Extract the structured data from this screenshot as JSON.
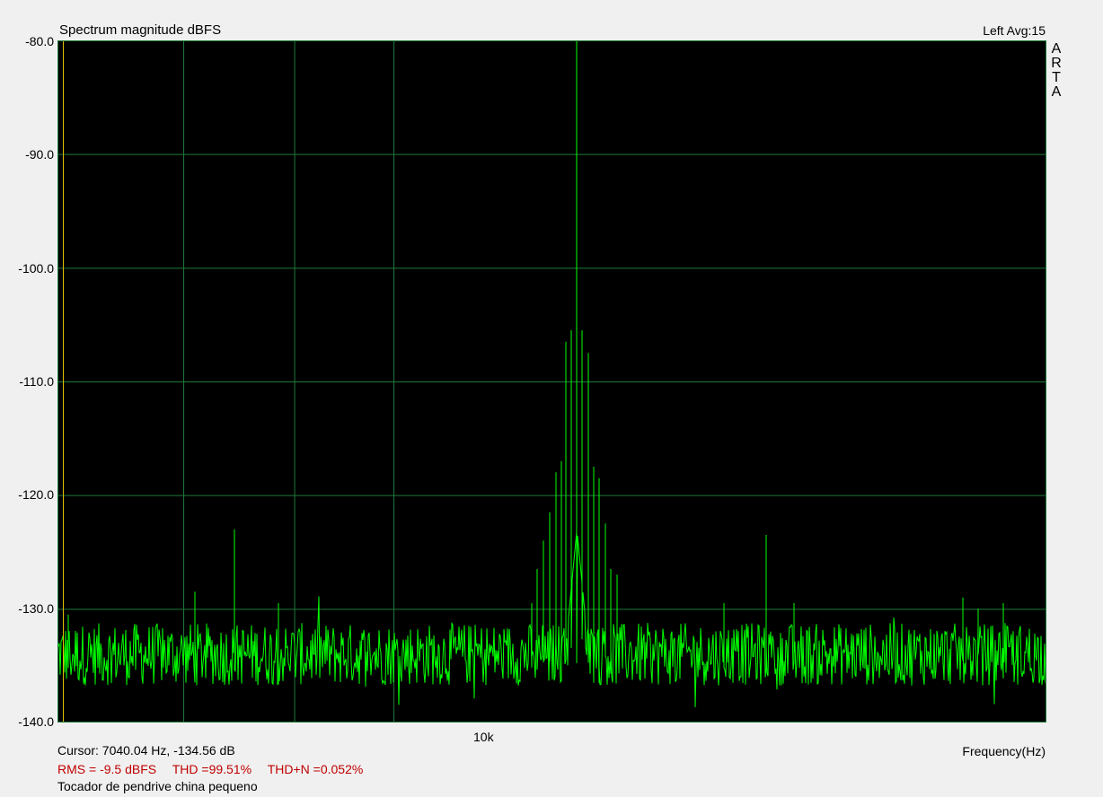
{
  "chart_data": {
    "type": "line",
    "title": "Spectrum magnitude dBFS",
    "channel_info": "Left  Avg:15",
    "brand_letters": [
      "A",
      "R",
      "T",
      "A"
    ],
    "xlabel": "Frequency(Hz)",
    "x_scale": "log",
    "xlim": [
      7000,
      20000
    ],
    "x_ticks": [
      {
        "value": 10000,
        "label": "10k"
      }
    ],
    "ylabel": "",
    "ylim": [
      -140,
      -80
    ],
    "y_ticks": [
      -80.0,
      -90.0,
      -100.0,
      -110.0,
      -120.0,
      -130.0,
      -140.0
    ],
    "y_tick_labels": [
      "-80.0",
      "-90.0",
      "-100.0",
      "-110.0",
      "-120.0",
      "-130.0",
      "-140.0"
    ],
    "grid": true,
    "colors": {
      "background": "#000000",
      "grid": "#1e7a3a",
      "trace": "#00ff00",
      "cursor": "#e0c000",
      "stats": "#c00000"
    },
    "series": [
      {
        "noise_floor_db": -134,
        "peaks": [
          {
            "freq": 12150,
            "db": -80.0
          },
          {
            "freq": 12080,
            "db": -105.5
          },
          {
            "freq": 12220,
            "db": -105.5
          },
          {
            "freq": 12010,
            "db": -106.5
          },
          {
            "freq": 12300,
            "db": -107.5
          },
          {
            "freq": 11950,
            "db": -117.0
          },
          {
            "freq": 12370,
            "db": -117.5
          },
          {
            "freq": 11880,
            "db": -118.0
          },
          {
            "freq": 12440,
            "db": -118.5
          },
          {
            "freq": 11800,
            "db": -121.5
          },
          {
            "freq": 12520,
            "db": -122.5
          },
          {
            "freq": 11720,
            "db": -124.0
          },
          {
            "freq": 11650,
            "db": -126.5
          },
          {
            "freq": 12600,
            "db": -126.5
          },
          {
            "freq": 12680,
            "db": -127.0
          },
          {
            "freq": 11580,
            "db": -129.5
          },
          {
            "freq": 8450,
            "db": -123.0
          },
          {
            "freq": 8100,
            "db": -128.5
          },
          {
            "freq": 8850,
            "db": -129.5
          },
          {
            "freq": 7080,
            "db": -130.5
          },
          {
            "freq": 14850,
            "db": -123.5
          },
          {
            "freq": 14200,
            "db": -129.5
          },
          {
            "freq": 15300,
            "db": -129.5
          },
          {
            "freq": 18300,
            "db": -129.0
          },
          {
            "freq": 18600,
            "db": -130.0
          },
          {
            "freq": 19100,
            "db": -129.5
          }
        ]
      }
    ]
  },
  "cursor_text": "Cursor: 7040.04 Hz, -134.56 dB",
  "cursor_freq": 7040.04,
  "stats": {
    "rms": "RMS =   -9.5 dBFS",
    "thd": "THD =99.51%",
    "thdn": "THD+N =0.052%"
  },
  "note": "Tocador de pendrive china pequeno"
}
